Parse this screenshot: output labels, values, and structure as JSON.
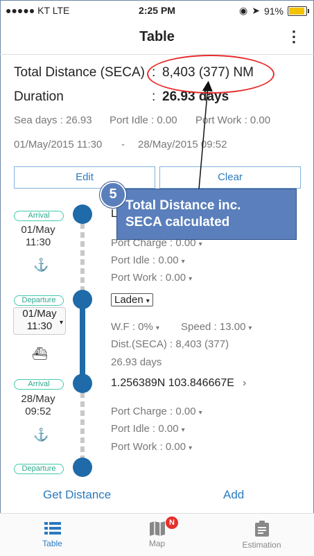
{
  "status": {
    "carrier": "●●●●● KT  LTE",
    "time": "2:25 PM",
    "battery": "91%",
    "battery_level": 0.91
  },
  "navbar": {
    "title": "Table",
    "more": "⋮"
  },
  "summary": {
    "total_label": "Total Distance (SECA)",
    "total_value": "8,403 (377) NM",
    "duration_label": "Duration",
    "duration_value": "26.93 days",
    "colon": ":",
    "sea_days": "Sea days : 26.93",
    "port_idle": "Port Idle : 0.00",
    "port_work": "Port Work : 0.00",
    "start": "01/May/2015 11:30",
    "dash": "-",
    "end": "28/May/2015 09:52"
  },
  "buttons": {
    "edit": "Edit",
    "clear": "Clear"
  },
  "annotation": {
    "number": "5",
    "line1": "Total Distance inc.",
    "line2": "SECA calculated"
  },
  "timeline": {
    "arrival_tag": "Arrival",
    "departure_tag": "Departure",
    "stop1": {
      "date": "01/May",
      "time": "11:30",
      "name_partial": "L",
      "port_charge": "Port Charge : 0.00",
      "port_idle": "Port Idle : 0.00",
      "port_work": "Port Work : 0.00"
    },
    "dep1": {
      "date": "01/May",
      "time": "11:30",
      "cargo": "Laden",
      "wf": "W.F : 0%",
      "speed": "Speed : 13.00",
      "dist": "Dist.(SECA) : 8,403 (377)",
      "days": "26.93 days"
    },
    "stop2": {
      "date": "28/May",
      "time": "09:52",
      "coords": "1.256389N 103.846667E",
      "port_charge": "Port Charge : 0.00",
      "port_idle": "Port Idle : 0.00",
      "port_work": "Port Work : 0.00"
    }
  },
  "actions": {
    "get_distance": "Get Distance",
    "add": "Add"
  },
  "tabs": [
    {
      "label": "Table",
      "icon": "list-icon"
    },
    {
      "label": "Map",
      "icon": "map-icon",
      "badge": "N"
    },
    {
      "label": "Estimation",
      "icon": "clipboard-icon"
    }
  ],
  "colors": {
    "accent": "#2a7abf",
    "node": "#1f6aa8",
    "tag": "#43c9ad",
    "callout": "#5a7fbc",
    "ellipse": "#e52b2b"
  }
}
